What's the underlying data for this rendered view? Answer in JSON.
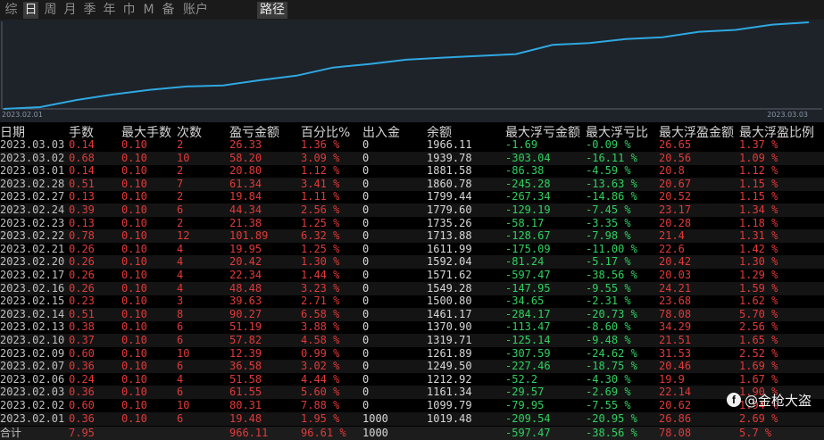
{
  "tabs": [
    {
      "label": "综",
      "active": false
    },
    {
      "label": "日",
      "active": true
    },
    {
      "label": "周",
      "active": false
    },
    {
      "label": "月",
      "active": false
    },
    {
      "label": "季",
      "active": false
    },
    {
      "label": "年",
      "active": false
    },
    {
      "label": "巾",
      "active": false
    },
    {
      "label": "M",
      "active": false
    },
    {
      "label": "备",
      "active": false
    },
    {
      "label": "账户",
      "active": false
    },
    {
      "label": "路径",
      "active": true
    }
  ],
  "chart": {
    "start_label": "2023.02.01",
    "end_label": "2023.03.03",
    "line_color": "#2fa8e0",
    "background": "#1e2229"
  },
  "headers": [
    "日期",
    "手数",
    "最大手数",
    "次数",
    "盈亏金额",
    "百分比%",
    "出入金",
    "余额",
    "最大浮亏金额",
    "最大浮亏比",
    "最大浮盈金额",
    "最大浮盈比例"
  ],
  "rows": [
    [
      "2023.03.03",
      "0.14",
      "0.10",
      "2",
      "26.33",
      "1.36 %",
      "0",
      "1966.11",
      "-1.69",
      "-0.09 %",
      "26.65",
      "1.37 %"
    ],
    [
      "2023.03.02",
      "0.68",
      "0.10",
      "10",
      "58.20",
      "3.09 %",
      "0",
      "1939.78",
      "-303.04",
      "-16.11 %",
      "20.56",
      "1.09 %"
    ],
    [
      "2023.03.01",
      "0.14",
      "0.10",
      "2",
      "20.80",
      "1.12 %",
      "0",
      "1881.58",
      "-86.38",
      "-4.59 %",
      "20.8",
      "1.12 %"
    ],
    [
      "2023.02.28",
      "0.51",
      "0.10",
      "7",
      "61.34",
      "3.41 %",
      "0",
      "1860.78",
      "-245.28",
      "-13.63 %",
      "20.67",
      "1.15 %"
    ],
    [
      "2023.02.27",
      "0.13",
      "0.10",
      "2",
      "19.84",
      "1.11 %",
      "0",
      "1799.44",
      "-267.34",
      "-14.86 %",
      "20.52",
      "1.15 %"
    ],
    [
      "2023.02.24",
      "0.39",
      "0.10",
      "6",
      "44.34",
      "2.56 %",
      "0",
      "1779.60",
      "-129.19",
      "-7.45 %",
      "23.17",
      "1.34 %"
    ],
    [
      "2023.02.23",
      "0.13",
      "0.10",
      "2",
      "21.38",
      "1.25 %",
      "0",
      "1735.26",
      "-58.17",
      "-3.35 %",
      "20.28",
      "1.18 %"
    ],
    [
      "2023.02.22",
      "0.78",
      "0.10",
      "12",
      "101.89",
      "6.32 %",
      "0",
      "1713.88",
      "-128.67",
      "-7.98 %",
      "21.4",
      "1.31 %"
    ],
    [
      "2023.02.21",
      "0.26",
      "0.10",
      "4",
      "19.95",
      "1.25 %",
      "0",
      "1611.99",
      "-175.09",
      "-11.00 %",
      "22.6",
      "1.42 %"
    ],
    [
      "2023.02.20",
      "0.26",
      "0.10",
      "4",
      "20.42",
      "1.30 %",
      "0",
      "1592.04",
      "-81.24",
      "-5.17 %",
      "20.42",
      "1.30 %"
    ],
    [
      "2023.02.17",
      "0.26",
      "0.10",
      "4",
      "22.34",
      "1.44 %",
      "0",
      "1571.62",
      "-597.47",
      "-38.56 %",
      "20.03",
      "1.29 %"
    ],
    [
      "2023.02.16",
      "0.26",
      "0.10",
      "4",
      "48.48",
      "3.23 %",
      "0",
      "1549.28",
      "-147.95",
      "-9.55 %",
      "24.21",
      "1.59 %"
    ],
    [
      "2023.02.15",
      "0.23",
      "0.10",
      "3",
      "39.63",
      "2.71 %",
      "0",
      "1500.80",
      "-34.65",
      "-2.31 %",
      "23.68",
      "1.62 %"
    ],
    [
      "2023.02.14",
      "0.51",
      "0.10",
      "8",
      "90.27",
      "6.58 %",
      "0",
      "1461.17",
      "-284.17",
      "-20.73 %",
      "78.08",
      "5.70 %"
    ],
    [
      "2023.02.13",
      "0.38",
      "0.10",
      "6",
      "51.19",
      "3.88 %",
      "0",
      "1370.90",
      "-113.47",
      "-8.60 %",
      "34.29",
      "2.56 %"
    ],
    [
      "2023.02.10",
      "0.37",
      "0.10",
      "6",
      "57.82",
      "4.58 %",
      "0",
      "1319.71",
      "-125.14",
      "-9.48 %",
      "21.51",
      "1.65 %"
    ],
    [
      "2023.02.09",
      "0.60",
      "0.10",
      "10",
      "12.39",
      "0.99 %",
      "0",
      "1261.89",
      "-307.59",
      "-24.62 %",
      "31.53",
      "2.52 %"
    ],
    [
      "2023.02.07",
      "0.36",
      "0.10",
      "6",
      "36.58",
      "3.02 %",
      "0",
      "1249.50",
      "-227.46",
      "-18.75 %",
      "20.46",
      "1.69 %"
    ],
    [
      "2023.02.06",
      "0.24",
      "0.10",
      "4",
      "51.58",
      "4.44 %",
      "0",
      "1212.92",
      "-52.2",
      "-4.30 %",
      "19.9",
      "1.67 %"
    ],
    [
      "2023.02.03",
      "0.36",
      "0.10",
      "6",
      "61.55",
      "5.60 %",
      "0",
      "1161.34",
      "-29.57",
      "-2.69 %",
      "22.14",
      "1.90 %"
    ],
    [
      "2023.02.02",
      "0.60",
      "0.10",
      "10",
      "80.31",
      "7.88 %",
      "0",
      "1099.79",
      "-79.95",
      "-7.55 %",
      "20.62",
      "1.94 %"
    ],
    [
      "2023.02.01",
      "0.36",
      "0.10",
      "6",
      "19.48",
      "1.95 %",
      "1000",
      "1019.48",
      "-209.54",
      "-20.95 %",
      "26.86",
      "2.69 %"
    ]
  ],
  "total": [
    "合计",
    "7.95",
    "",
    "",
    "966.11",
    "96.61 %",
    "1000",
    "",
    "-597.47",
    "-38.56 %",
    "78.08",
    "5.7 %"
  ],
  "watermark": {
    "icon": "f",
    "text": "@金枪大盗"
  }
}
